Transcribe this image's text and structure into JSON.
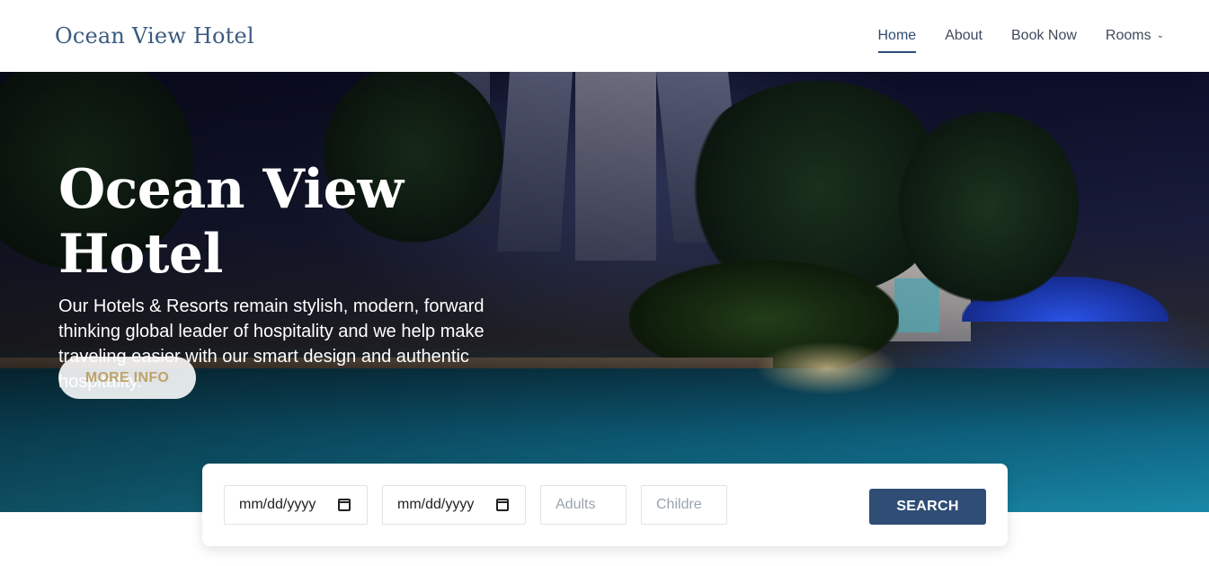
{
  "header": {
    "brand": "Ocean View Hotel",
    "nav": [
      {
        "label": "Home",
        "active": true
      },
      {
        "label": "About"
      },
      {
        "label": "Book Now"
      },
      {
        "label": "Rooms",
        "dropdown": true
      }
    ],
    "chevron_icon": "chevron-down-icon"
  },
  "hero": {
    "title": "Ocean View Hotel",
    "text": "Our Hotels & Resorts remain stylish, modern, forward thinking global leader of hospitality and we help make traveling easier with our smart design and authentic hospitality.",
    "button_label": "MORE INFO"
  },
  "search": {
    "checkin_value": "mm/dd/yyyy",
    "checkout_value": "mm/dd/yyyy",
    "adults_placeholder": "Adults",
    "children_placeholder": "Childre",
    "button_label": "SEARCH"
  },
  "colors": {
    "brand": "#3b5a80",
    "accent": "#2f4d75",
    "more_info_text": "#bfa36a"
  }
}
